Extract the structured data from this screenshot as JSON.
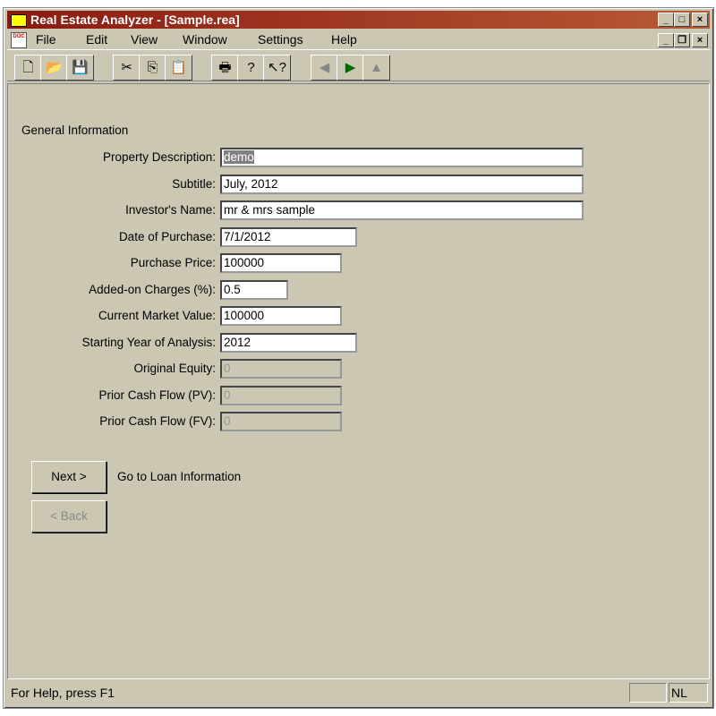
{
  "window": {
    "title": "Real Estate Analyzer - [Sample.rea]",
    "controls": [
      "_",
      "□",
      "×"
    ],
    "mdi_controls": [
      "_",
      "❐",
      "×"
    ]
  },
  "menu": [
    {
      "label": "File"
    },
    {
      "label": "Edit"
    },
    {
      "label": "View"
    },
    {
      "label": "Window"
    },
    {
      "label": "Settings"
    },
    {
      "label": "Help"
    }
  ],
  "toolbar": [
    {
      "name": "new-icon",
      "glyph": "🗋"
    },
    {
      "name": "open-icon",
      "glyph": "📂"
    },
    {
      "name": "save-icon",
      "glyph": "💾"
    },
    {
      "name": "cut-icon",
      "glyph": "✂"
    },
    {
      "name": "copy-icon",
      "glyph": "⎘"
    },
    {
      "name": "paste-icon",
      "glyph": "📋"
    },
    {
      "name": "print-icon",
      "glyph": "🖶"
    },
    {
      "name": "help-icon",
      "glyph": "?"
    },
    {
      "name": "context-help-icon",
      "glyph": "↖?"
    },
    {
      "name": "previous-icon",
      "glyph": "◀"
    },
    {
      "name": "next-icon",
      "glyph": "▶"
    },
    {
      "name": "up-icon",
      "glyph": "▲"
    }
  ],
  "form": {
    "section": "General Information",
    "fields": [
      {
        "label": "Property Description:",
        "value": "demo",
        "disabled": false
      },
      {
        "label": "Subtitle:",
        "value": "July, 2012",
        "disabled": false
      },
      {
        "label": "Investor's Name:",
        "value": "mr & mrs sample",
        "disabled": false
      },
      {
        "label": "Date of Purchase:",
        "value": "7/1/2012",
        "disabled": false
      },
      {
        "label": "Purchase Price:",
        "value": "100000",
        "disabled": false
      },
      {
        "label": "Added-on Charges (%):",
        "value": "0.5",
        "disabled": false
      },
      {
        "label": "Current Market Value:",
        "value": "100000",
        "disabled": false
      },
      {
        "label": "Starting Year of Analysis:",
        "value": "2012",
        "disabled": false
      },
      {
        "label": "Original Equity:",
        "value": "0",
        "disabled": true
      },
      {
        "label": "Prior Cash Flow (PV):",
        "value": "0",
        "disabled": true
      },
      {
        "label": "Prior Cash Flow (FV):",
        "value": "0",
        "disabled": true
      }
    ],
    "next_label": "Next >",
    "next_desc": "Go to Loan Information",
    "back_label": "< Back"
  },
  "status": {
    "text": "For Help, press F1",
    "indicator": "NL"
  }
}
